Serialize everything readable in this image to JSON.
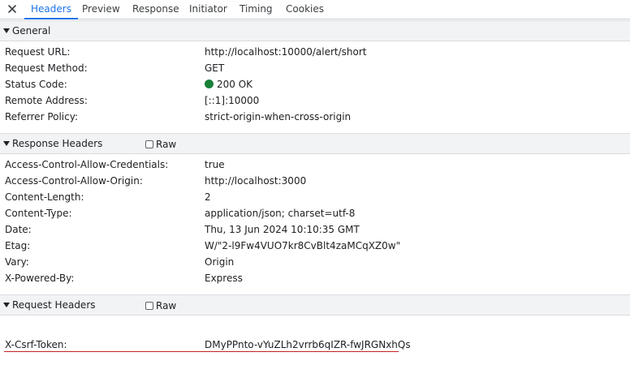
{
  "tabs": {
    "close_glyph": "✕",
    "items": [
      "Headers",
      "Preview",
      "Response",
      "Initiator",
      "Timing",
      "Cookies"
    ],
    "active": "Headers"
  },
  "general": {
    "title": "General",
    "rows": [
      {
        "key": "Request URL:",
        "value": "http://localhost:10000/alert/short"
      },
      {
        "key": "Request Method:",
        "value": "GET"
      },
      {
        "key": "Status Code:",
        "value": "200 OK"
      },
      {
        "key": "Remote Address:",
        "value": "[::1]:10000"
      },
      {
        "key": "Referrer Policy:",
        "value": "strict-origin-when-cross-origin"
      }
    ],
    "status_color": "#188038"
  },
  "response_headers": {
    "title": "Response Headers",
    "raw_label": "Raw",
    "rows": [
      {
        "key": "Access-Control-Allow-Credentials:",
        "value": "true"
      },
      {
        "key": "Access-Control-Allow-Origin:",
        "value": "http://localhost:3000"
      },
      {
        "key": "Content-Length:",
        "value": "2"
      },
      {
        "key": "Content-Type:",
        "value": "application/json; charset=utf-8"
      },
      {
        "key": "Date:",
        "value": "Thu, 13 Jun 2024 10:10:35 GMT"
      },
      {
        "key": "Etag:",
        "value": "W/\"2-l9Fw4VUO7kr8CvBlt4zaMCqXZ0w\""
      },
      {
        "key": "Vary:",
        "value": "Origin"
      },
      {
        "key": "X-Powered-By:",
        "value": "Express"
      }
    ]
  },
  "request_headers": {
    "title": "Request Headers",
    "raw_label": "Raw",
    "rows": [
      {
        "key": "X-Csrf-Token:",
        "value": "DMyPPnto-vYuZLh2vrrb6qIZR-fwJRGNxhQs"
      }
    ],
    "highlight_color": "#c5221f"
  },
  "accent_color": "#1a73e8"
}
